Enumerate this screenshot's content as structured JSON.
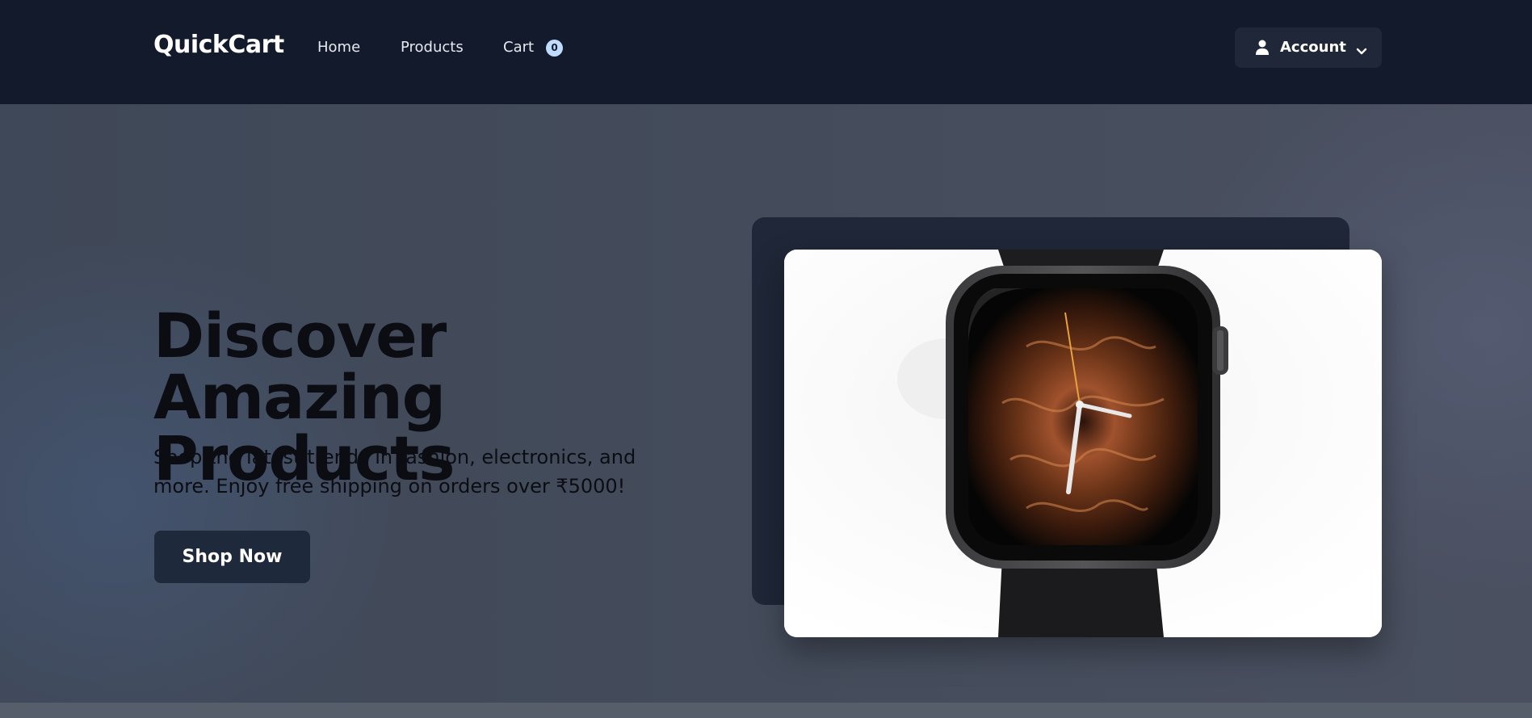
{
  "nav": {
    "brand": "QuickCart",
    "links": [
      {
        "label": "Home"
      },
      {
        "label": "Products"
      },
      {
        "label": "Cart"
      }
    ],
    "cart_count": "0",
    "account_label": "Account"
  },
  "hero": {
    "title_line1": "Discover Amazing",
    "title_line2": "Products",
    "subtitle": "Shop the latest trends in fashion, electronics, and more. Enjoy free shipping on orders over ₹5000!",
    "cta_label": "Shop Now",
    "image_subject": "smartwatch-product-photo"
  },
  "colors": {
    "nav_bg": "#131a2b",
    "hero_bg": "#444c5b",
    "button_bg": "#1e293b",
    "badge_bg": "#bfdbfe",
    "text_dark": "#0b0d12"
  }
}
